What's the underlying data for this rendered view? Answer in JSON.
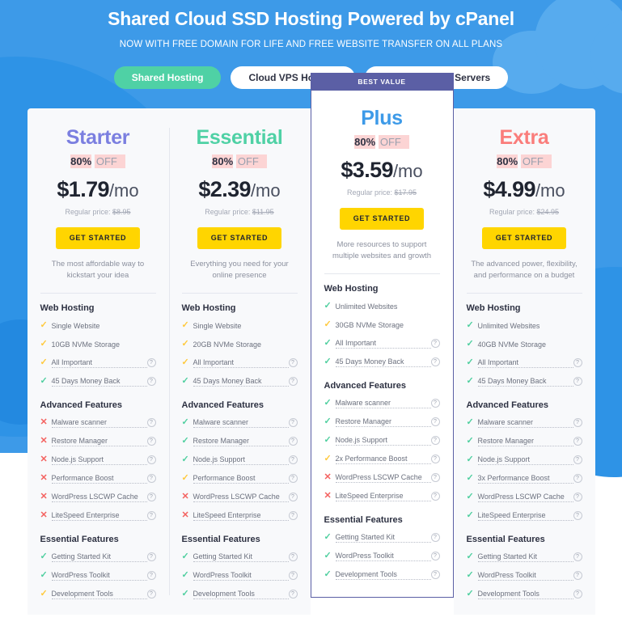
{
  "hero": {
    "title": "Shared Cloud SSD Hosting Powered by cPanel",
    "subtitle": "NOW WITH FREE DOMAIN FOR LIFE AND FREE WEBSITE TRANSFER ON ALL PLANS"
  },
  "tabs": [
    {
      "label": "Shared Hosting",
      "active": true
    },
    {
      "label": "Cloud VPS Hosting",
      "active": false
    },
    {
      "label": "Dedicated CPU Servers",
      "active": false
    }
  ],
  "colors": {
    "page_background": "#3d9ae8",
    "tab_active": "#4fd1a5",
    "badge": "#5b5fa5",
    "cta": "#ffd500",
    "check_full": "#4fcf9f",
    "check_partial": "#ffc93c",
    "cross": "#f4615f",
    "discount_highlight": "#fcd4d4"
  },
  "labels": {
    "regular_price_prefix": "Regular price: ",
    "cta": "GET STARTED",
    "badge": "BEST VALUE",
    "help_icon": "?",
    "check_icon": "✓",
    "cross_icon": "✕"
  },
  "group_titles": {
    "web": "Web Hosting",
    "advanced": "Advanced Features",
    "essential": "Essential Features"
  },
  "plans": [
    {
      "name": "Starter",
      "name_color": "#7b7fe0",
      "featured": false,
      "discount_pct": "80%",
      "discount_off": "OFF",
      "price": "$1.79",
      "period": "/mo",
      "regular_price": "$8.95",
      "tagline": "The most affordable way to kickstart your idea",
      "web_hosting": [
        {
          "label": "Single Website",
          "state": "part",
          "help": false
        },
        {
          "label": "10GB NVMe Storage",
          "state": "part",
          "help": false
        },
        {
          "label": "All Important",
          "state": "part",
          "help": true
        },
        {
          "label": "45 Days Money Back",
          "state": "yes",
          "help": true
        }
      ],
      "advanced_features": [
        {
          "label": "Malware scanner",
          "state": "no",
          "help": true
        },
        {
          "label": "Restore Manager",
          "state": "no",
          "help": true
        },
        {
          "label": "Node.js Support",
          "state": "no",
          "help": true
        },
        {
          "label": "Performance Boost",
          "state": "no",
          "help": true
        },
        {
          "label": "WordPress LSCWP Cache",
          "state": "no",
          "help": true
        },
        {
          "label": "LiteSpeed Enterprise",
          "state": "no",
          "help": true
        }
      ],
      "essential_features": [
        {
          "label": "Getting Started Kit",
          "state": "yes",
          "help": true
        },
        {
          "label": "WordPress Toolkit",
          "state": "yes",
          "help": true
        },
        {
          "label": "Development Tools",
          "state": "part",
          "help": true
        }
      ]
    },
    {
      "name": "Essential",
      "name_color": "#4fd1a5",
      "featured": false,
      "discount_pct": "80%",
      "discount_off": "OFF",
      "price": "$2.39",
      "period": "/mo",
      "regular_price": "$11.95",
      "tagline": "Everything you need for your online presence",
      "web_hosting": [
        {
          "label": "Single Website",
          "state": "part",
          "help": false
        },
        {
          "label": "20GB NVMe Storage",
          "state": "part",
          "help": false
        },
        {
          "label": "All Important",
          "state": "part",
          "help": true
        },
        {
          "label": "45 Days Money Back",
          "state": "yes",
          "help": true
        }
      ],
      "advanced_features": [
        {
          "label": "Malware scanner",
          "state": "yes",
          "help": true
        },
        {
          "label": "Restore Manager",
          "state": "yes",
          "help": true
        },
        {
          "label": "Node.js Support",
          "state": "yes",
          "help": true
        },
        {
          "label": "Performance Boost",
          "state": "part",
          "help": true
        },
        {
          "label": "WordPress LSCWP Cache",
          "state": "no",
          "help": true
        },
        {
          "label": "LiteSpeed Enterprise",
          "state": "no",
          "help": true
        }
      ],
      "essential_features": [
        {
          "label": "Getting Started Kit",
          "state": "yes",
          "help": true
        },
        {
          "label": "WordPress Toolkit",
          "state": "yes",
          "help": true
        },
        {
          "label": "Development Tools",
          "state": "yes",
          "help": true
        }
      ]
    },
    {
      "name": "Plus",
      "name_color": "#3d9ae8",
      "featured": true,
      "badge": "BEST VALUE",
      "discount_pct": "80%",
      "discount_off": "OFF",
      "price": "$3.59",
      "period": "/mo",
      "regular_price": "$17.95",
      "tagline": "More resources to support multiple websites and growth",
      "web_hosting": [
        {
          "label": "Unlimited Websites",
          "state": "yes",
          "help": false
        },
        {
          "label": "30GB NVMe Storage",
          "state": "part",
          "help": false
        },
        {
          "label": "All Important",
          "state": "yes",
          "help": true
        },
        {
          "label": "45 Days Money Back",
          "state": "yes",
          "help": true
        }
      ],
      "advanced_features": [
        {
          "label": "Malware scanner",
          "state": "yes",
          "help": true
        },
        {
          "label": "Restore Manager",
          "state": "yes",
          "help": true
        },
        {
          "label": "Node.js Support",
          "state": "yes",
          "help": true
        },
        {
          "label": "2x Performance Boost",
          "state": "part",
          "help": true
        },
        {
          "label": "WordPress LSCWP Cache",
          "state": "no",
          "help": true
        },
        {
          "label": "LiteSpeed Enterprise",
          "state": "no",
          "help": true
        }
      ],
      "essential_features": [
        {
          "label": "Getting Started Kit",
          "state": "yes",
          "help": true
        },
        {
          "label": "WordPress Toolkit",
          "state": "yes",
          "help": true
        },
        {
          "label": "Development Tools",
          "state": "yes",
          "help": true
        }
      ]
    },
    {
      "name": "Extra",
      "name_color": "#fa7d7b",
      "featured": false,
      "discount_pct": "80%",
      "discount_off": "OFF",
      "price": "$4.99",
      "period": "/mo",
      "regular_price": "$24.95",
      "tagline": "The advanced power, flexibility, and performance on a budget",
      "web_hosting": [
        {
          "label": "Unlimited Websites",
          "state": "yes",
          "help": false
        },
        {
          "label": "40GB NVMe Storage",
          "state": "yes",
          "help": false
        },
        {
          "label": "All Important",
          "state": "yes",
          "help": true
        },
        {
          "label": "45 Days Money Back",
          "state": "yes",
          "help": true
        }
      ],
      "advanced_features": [
        {
          "label": "Malware scanner",
          "state": "yes",
          "help": true
        },
        {
          "label": "Restore Manager",
          "state": "yes",
          "help": true
        },
        {
          "label": "Node.js Support",
          "state": "yes",
          "help": true
        },
        {
          "label": "3x Performance Boost",
          "state": "yes",
          "help": true
        },
        {
          "label": "WordPress LSCWP Cache",
          "state": "yes",
          "help": true
        },
        {
          "label": "LiteSpeed Enterprise",
          "state": "yes",
          "help": true
        }
      ],
      "essential_features": [
        {
          "label": "Getting Started Kit",
          "state": "yes",
          "help": true
        },
        {
          "label": "WordPress Toolkit",
          "state": "yes",
          "help": true
        },
        {
          "label": "Development Tools",
          "state": "yes",
          "help": true
        }
      ]
    }
  ]
}
